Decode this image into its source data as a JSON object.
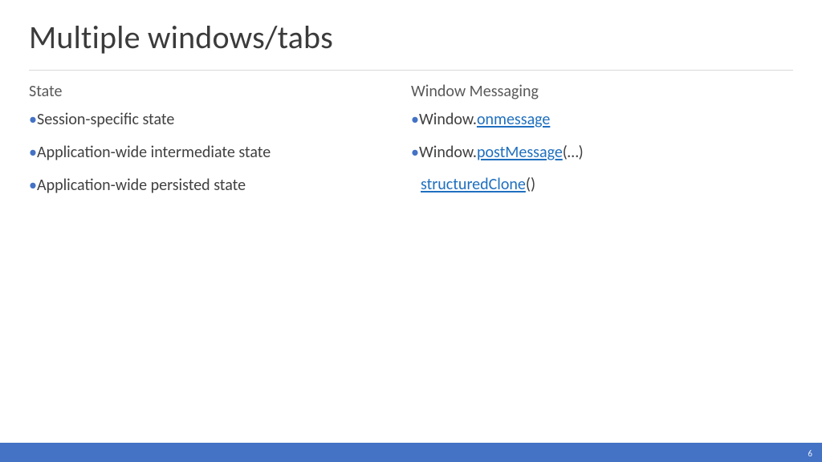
{
  "title": "Multiple windows/tabs",
  "left": {
    "heading": "State",
    "items": [
      {
        "text": "Session-specific state"
      },
      {
        "text": "Application-wide intermediate state"
      },
      {
        "text": "Application-wide persisted state"
      }
    ]
  },
  "right": {
    "heading": "Window Messaging",
    "items": [
      {
        "prefix": "Window.",
        "link": "onmessage",
        "suffix": ""
      },
      {
        "prefix": "Window.",
        "link": "postMessage",
        "suffix": "(…)"
      }
    ],
    "extra": {
      "link": "structuredClone",
      "suffix": "()"
    }
  },
  "pageNumber": "6"
}
